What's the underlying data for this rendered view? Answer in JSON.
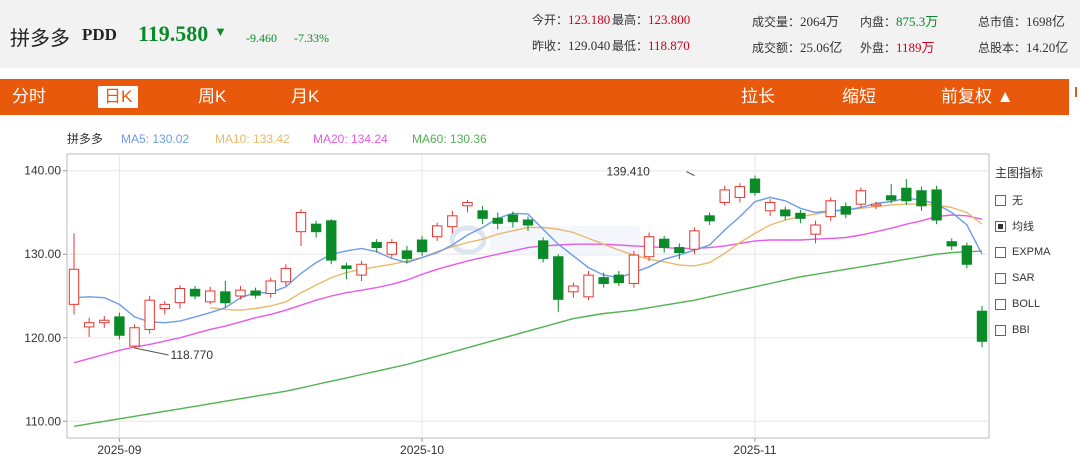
{
  "stock": {
    "name": "拼多多",
    "code": "PDD",
    "price": "119.580",
    "arrow": "▼",
    "change": "-9.460",
    "change_pct": "-7.33%"
  },
  "quotes": [
    {
      "label": "今开：",
      "value": "123.180",
      "tone": "red"
    },
    {
      "label": "最高：",
      "value": "123.800",
      "tone": "red"
    },
    {
      "label": "成交量：",
      "value": "2064万",
      "tone": ""
    },
    {
      "label": "内盘：",
      "value": "875.3万",
      "tone": "green"
    },
    {
      "label": "总市值：",
      "value": "1698亿",
      "tone": ""
    },
    {
      "label": "昨收：",
      "value": "129.040",
      "tone": ""
    },
    {
      "label": "最低：",
      "value": "118.870",
      "tone": "red"
    },
    {
      "label": "成交额：",
      "value": "25.06亿",
      "tone": ""
    },
    {
      "label": "外盘：",
      "value": "1189万",
      "tone": "red"
    },
    {
      "label": "总股本：",
      "value": "14.20亿",
      "tone": ""
    }
  ],
  "tabs": {
    "intraday": "分时",
    "daily": "日K",
    "weekly": "周K",
    "monthly": "月K",
    "zoom_in": "拉长",
    "zoom_out": "缩短",
    "adjust": "前复权 ▲"
  },
  "indicators": {
    "title": "主图指标",
    "items": [
      {
        "label": "无",
        "checked": false
      },
      {
        "label": "均线",
        "checked": true
      },
      {
        "label": "EXPMA",
        "checked": false
      },
      {
        "label": "SAR",
        "checked": false
      },
      {
        "label": "BOLL",
        "checked": false
      },
      {
        "label": "BBI",
        "checked": false
      }
    ]
  },
  "colors": {
    "up": "#e8352f",
    "down": "#0b8a28",
    "ma5": "#6f9ce8",
    "ma10": "#e8b96a",
    "ma20": "#e85ae8",
    "ma60": "#52b152",
    "accent": "#e8590c"
  },
  "chart_data": {
    "type": "candlestick",
    "legend": {
      "name": "拼多多",
      "items": [
        {
          "key": "ma5",
          "text": "MA5: 130.02"
        },
        {
          "key": "ma10",
          "text": "MA10: 133.42"
        },
        {
          "key": "ma20",
          "text": "MA20: 134.24"
        },
        {
          "key": "ma60",
          "text": "MA60: 130.36"
        }
      ]
    },
    "ylim": [
      108,
      142
    ],
    "yticks": [
      "140.00",
      "130.00",
      "120.00",
      "110.00"
    ],
    "ytick_values": [
      140,
      130,
      120,
      110
    ],
    "xticks": [
      {
        "label": "2025-09",
        "index": 3
      },
      {
        "label": "2025-10",
        "index": 23
      },
      {
        "label": "2025-11",
        "index": 45
      }
    ],
    "annotations": [
      {
        "text": "118.770",
        "index": 4,
        "value": 118.77
      },
      {
        "text": "139.410",
        "index": 41,
        "value": 139.41
      }
    ],
    "candles": [
      [
        124,
        128.2,
        132.5,
        122.8
      ],
      [
        121.3,
        121.8,
        122.4,
        120.1
      ],
      [
        121.8,
        122.1,
        122.6,
        121.2
      ],
      [
        122.5,
        120.3,
        123.0,
        119.8
      ],
      [
        119.0,
        121.2,
        121.6,
        118.77
      ],
      [
        121.0,
        124.5,
        125.0,
        120.5
      ],
      [
        123.5,
        124.0,
        124.4,
        122.8
      ],
      [
        124.2,
        125.9,
        126.3,
        123.5
      ],
      [
        125.8,
        125.0,
        126.2,
        124.6
      ],
      [
        124.3,
        125.6,
        126.1,
        124.0
      ],
      [
        125.5,
        124.2,
        126.8,
        123.6
      ],
      [
        125.0,
        125.7,
        126.2,
        124.6
      ],
      [
        125.6,
        125.1,
        126.0,
        124.7
      ],
      [
        125.3,
        126.8,
        127.2,
        124.8
      ],
      [
        126.7,
        128.3,
        128.8,
        126.2
      ],
      [
        132.7,
        135.0,
        135.4,
        131.0
      ],
      [
        133.6,
        132.7,
        134.0,
        132.0
      ],
      [
        134.0,
        129.3,
        134.2,
        128.8
      ],
      [
        128.6,
        128.3,
        129.0,
        127.0
      ],
      [
        127.5,
        128.8,
        129.2,
        126.8
      ],
      [
        131.4,
        130.8,
        131.8,
        130.2
      ],
      [
        130.0,
        131.4,
        131.8,
        129.6
      ],
      [
        130.4,
        129.5,
        131.0,
        128.9
      ],
      [
        131.7,
        130.3,
        132.2,
        129.8
      ],
      [
        132.1,
        133.4,
        133.8,
        131.6
      ],
      [
        133.3,
        134.6,
        135.2,
        132.5
      ],
      [
        135.8,
        136.2,
        136.5,
        135.0
      ],
      [
        135.2,
        134.3,
        135.8,
        133.6
      ],
      [
        134.3,
        133.7,
        135.0,
        133.0
      ],
      [
        134.7,
        133.9,
        135.1,
        133.2
      ],
      [
        134.1,
        133.5,
        134.5,
        132.8
      ],
      [
        131.6,
        129.5,
        132.0,
        129.0
      ],
      [
        129.7,
        124.6,
        130.0,
        123.1
      ],
      [
        125.5,
        126.2,
        126.6,
        124.8
      ],
      [
        124.9,
        127.5,
        128.0,
        124.5
      ],
      [
        127.2,
        126.5,
        127.8,
        126.0
      ],
      [
        127.5,
        126.6,
        128.0,
        126.2
      ],
      [
        126.5,
        129.9,
        130.4,
        126.0
      ],
      [
        129.7,
        132.1,
        132.6,
        129.2
      ],
      [
        131.8,
        130.8,
        132.2,
        130.2
      ],
      [
        130.8,
        130.2,
        131.3,
        129.4
      ],
      [
        130.6,
        132.8,
        133.2,
        130.0
      ],
      [
        134.6,
        134.0,
        135.0,
        133.5
      ],
      [
        136.2,
        137.7,
        138.2,
        135.8
      ],
      [
        136.8,
        138.1,
        138.5,
        136.2
      ],
      [
        139.0,
        137.4,
        139.41,
        137.0
      ],
      [
        135.2,
        136.2,
        136.6,
        134.6
      ],
      [
        135.3,
        134.6,
        135.7,
        134.1
      ],
      [
        134.9,
        134.3,
        135.3,
        133.7
      ],
      [
        132.4,
        133.5,
        134.0,
        131.3
      ],
      [
        134.5,
        136.4,
        136.8,
        134.0
      ],
      [
        135.7,
        134.8,
        136.2,
        134.3
      ],
      [
        136.0,
        137.6,
        138.0,
        135.6
      ],
      [
        135.8,
        136.0,
        136.3,
        135.4
      ],
      [
        137.0,
        136.5,
        138.4,
        136.1
      ],
      [
        137.9,
        136.4,
        139.0,
        135.9
      ],
      [
        137.6,
        135.8,
        138.1,
        135.2
      ],
      [
        137.7,
        134.1,
        138.2,
        133.6
      ],
      [
        131.5,
        131.0,
        131.9,
        130.5
      ],
      [
        131.0,
        128.8,
        131.4,
        128.3
      ],
      [
        123.18,
        119.58,
        123.8,
        118.87
      ]
    ],
    "ma5": [
      124.8,
      124.9,
      124.8,
      124.0,
      122.5,
      121.9,
      121.8,
      122.0,
      122.5,
      123.0,
      123.6,
      124.8,
      125.4,
      125.4,
      126.1,
      127.7,
      129.0,
      130.0,
      130.4,
      130.7,
      130.3,
      129.5,
      129.0,
      129.6,
      130.2,
      131.1,
      132.3,
      133.2,
      134.3,
      134.9,
      134.8,
      133.0,
      131.2,
      129.8,
      128.4,
      127.5,
      127.2,
      127.8,
      128.5,
      129.4,
      129.9,
      130.5,
      131.1,
      132.9,
      134.5,
      136.3,
      136.8,
      136.4,
      135.5,
      135.0,
      135.2,
      135.3,
      135.6,
      136.1,
      136.3,
      136.7,
      136.5,
      136.0,
      135.0,
      133.5,
      130.0
    ],
    "ma10": [
      null,
      null,
      null,
      null,
      null,
      null,
      null,
      null,
      null,
      123.6,
      123.4,
      123.3,
      123.5,
      123.8,
      124.3,
      125.4,
      126.3,
      127.2,
      127.8,
      128.2,
      128.5,
      128.8,
      129.2,
      129.6,
      130.3,
      130.9,
      131.4,
      131.8,
      132.4,
      132.8,
      133.2,
      133.2,
      133.0,
      132.6,
      131.9,
      131.2,
      130.5,
      129.9,
      129.4,
      129.1,
      128.7,
      128.6,
      129.0,
      130.1,
      131.4,
      132.5,
      133.5,
      134.1,
      134.5,
      134.8,
      135.1,
      135.3,
      135.5,
      135.7,
      135.9,
      136.0,
      136.0,
      135.9,
      135.6,
      135.0,
      133.6
    ],
    "ma20": [
      117.0,
      117.5,
      118.0,
      118.5,
      118.9,
      119.2,
      119.6,
      120.0,
      120.5,
      121.0,
      121.4,
      121.9,
      122.4,
      122.8,
      123.3,
      123.9,
      124.5,
      125.0,
      125.4,
      125.7,
      126.0,
      126.4,
      126.9,
      127.6,
      128.2,
      128.7,
      129.2,
      129.6,
      130.0,
      130.4,
      130.8,
      131.0,
      131.1,
      131.2,
      131.2,
      131.2,
      131.1,
      131.0,
      130.9,
      130.8,
      130.7,
      130.7,
      130.8,
      131.0,
      131.3,
      131.6,
      131.7,
      131.7,
      131.7,
      131.8,
      131.9,
      132.0,
      132.3,
      132.7,
      133.1,
      133.6,
      134.0,
      134.5,
      134.7,
      134.6,
      134.2
    ],
    "ma60": [
      109.4,
      109.7,
      110.0,
      110.3,
      110.6,
      110.9,
      111.2,
      111.5,
      111.8,
      112.1,
      112.4,
      112.7,
      113.0,
      113.3,
      113.6,
      114.0,
      114.4,
      114.8,
      115.2,
      115.6,
      116.0,
      116.4,
      116.8,
      117.3,
      117.8,
      118.3,
      118.8,
      119.3,
      119.8,
      120.3,
      120.8,
      121.3,
      121.8,
      122.3,
      122.6,
      122.9,
      123.1,
      123.3,
      123.6,
      123.9,
      124.2,
      124.5,
      124.9,
      125.3,
      125.7,
      126.1,
      126.5,
      126.9,
      127.3,
      127.6,
      127.9,
      128.2,
      128.5,
      128.8,
      129.1,
      129.4,
      129.7,
      130.0,
      130.2,
      130.3,
      130.36
    ]
  }
}
